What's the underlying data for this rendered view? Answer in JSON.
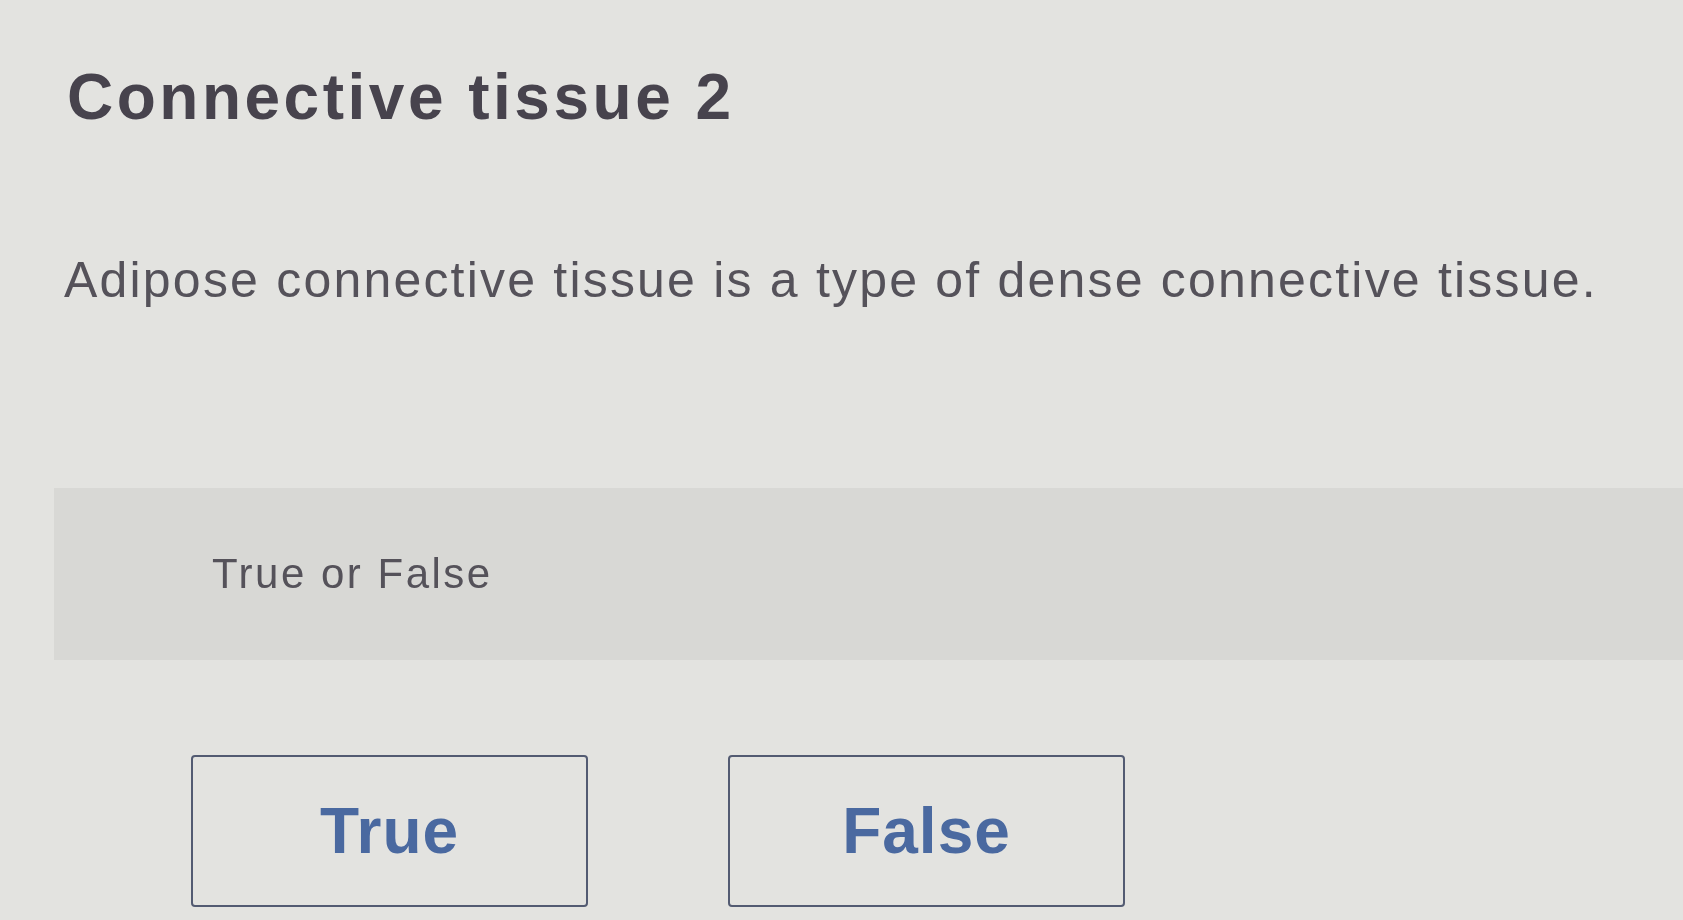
{
  "title": "Connective tissue 2",
  "statement": "Adipose connective tissue is a type of dense connective tissue.",
  "question_type": "True or False",
  "options": [
    {
      "label": "True",
      "selected": false
    },
    {
      "label": "False",
      "selected": false
    }
  ]
}
